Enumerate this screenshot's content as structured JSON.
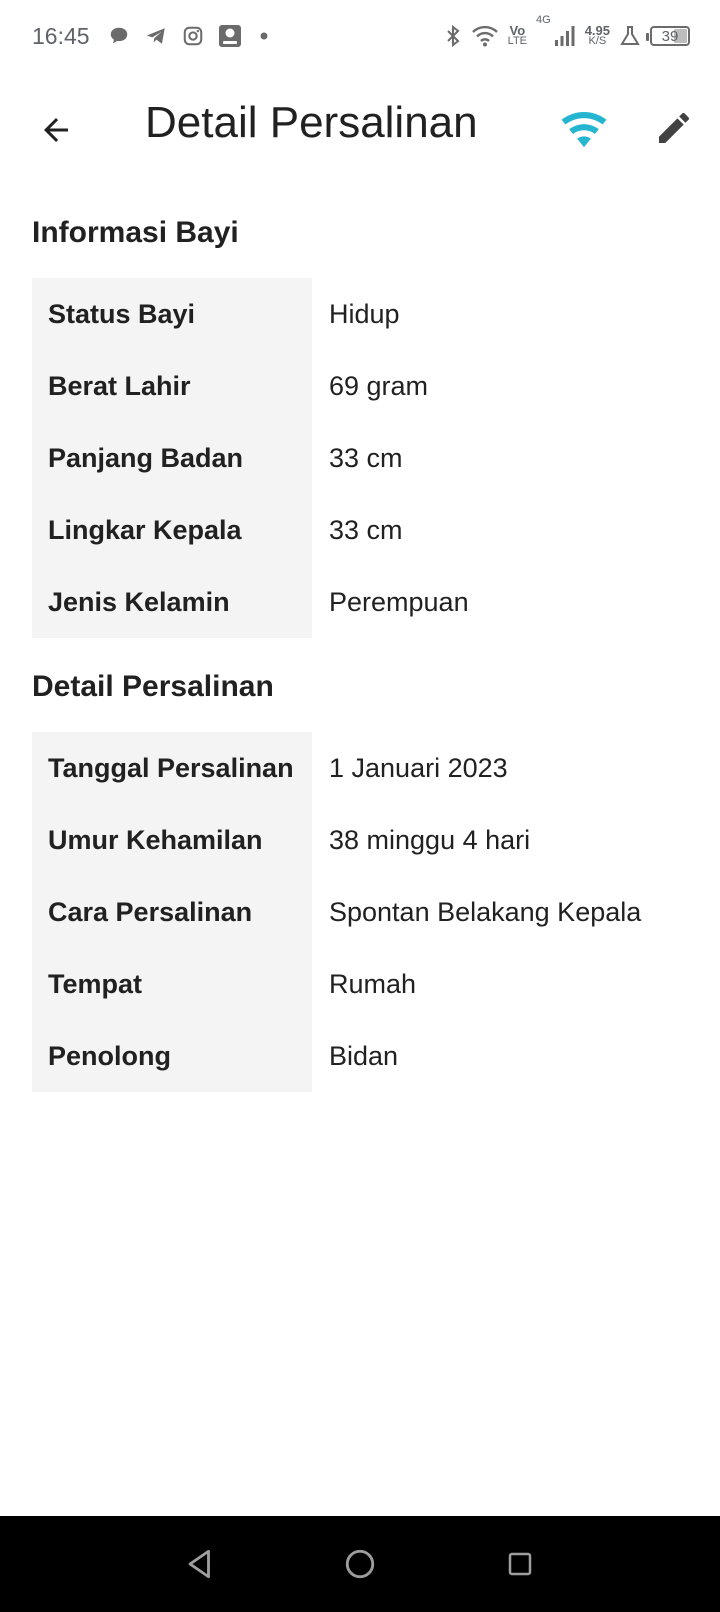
{
  "status_bar": {
    "time": "16:45",
    "volte_top": "Vo",
    "volte_bottom": "LTE",
    "network_type": "4G",
    "speed_value": "4.95",
    "speed_unit": "K/S",
    "battery": "39",
    "icons": [
      "chat-bubble-icon",
      "telegram-icon",
      "instagram-icon",
      "tiket-app-icon",
      "dot-icon",
      "bluetooth-icon",
      "wifi-icon",
      "signal-icon",
      "lab-flask-icon",
      "battery-icon"
    ]
  },
  "app_bar": {
    "title": "Detail Persalinan",
    "accent_color": "#26b5d0",
    "icons": [
      "back-arrow-icon",
      "wifi-icon",
      "edit-pencil-icon"
    ]
  },
  "baby_info": {
    "title": "Informasi Bayi",
    "rows": [
      {
        "label": "Status Bayi",
        "value": "Hidup"
      },
      {
        "label": "Berat Lahir",
        "value": "69 gram"
      },
      {
        "label": "Panjang Badan",
        "value": "33 cm"
      },
      {
        "label": "Lingkar Kepala",
        "value": "33 cm"
      },
      {
        "label": "Jenis Kelamin",
        "value": "Perempuan"
      }
    ]
  },
  "delivery_info": {
    "title": "Detail Persalinan",
    "rows": [
      {
        "label": "Tanggal Persalinan",
        "value": "1 Januari 2023"
      },
      {
        "label": "Umur Kehamilan",
        "value": "38 minggu 4 hari"
      },
      {
        "label": "Cara Persalinan",
        "value": "Spontan Belakang Kepala"
      },
      {
        "label": "Tempat",
        "value": "Rumah"
      },
      {
        "label": "Penolong",
        "value": "Bidan"
      }
    ]
  },
  "nav_bar": {
    "icons": [
      "back-triangle-icon",
      "home-circle-icon",
      "recents-square-icon"
    ]
  }
}
